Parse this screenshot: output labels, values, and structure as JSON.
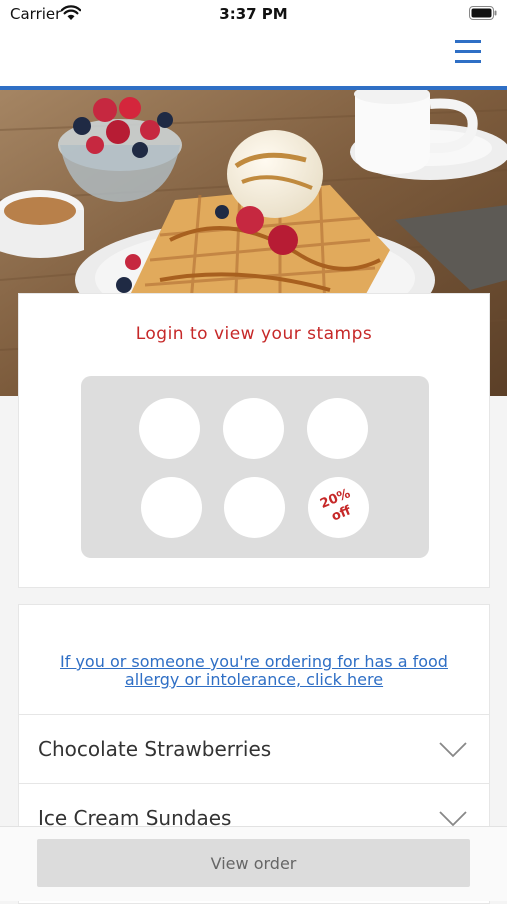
{
  "status_bar": {
    "carrier": "Carrier",
    "time": "3:37 PM",
    "icons": [
      "wifi-icon",
      "battery-icon"
    ]
  },
  "nav": {
    "menu_icon": "hamburger-menu-icon",
    "accent_color": "#2f6fc5"
  },
  "hero": {
    "image": "waffles-with-ice-cream-and-berries"
  },
  "stamp_card": {
    "title": "Login to view your stamps",
    "title_color": "#c62828",
    "stamps_total": 6,
    "stamps_collected": 0,
    "reward_lines": [
      "20%",
      "off"
    ]
  },
  "menu": {
    "allergy_link_lines": [
      "If you or someone you're ordering for has a food",
      "allergy or intolerance, click here"
    ],
    "categories": [
      {
        "label": "Chocolate Strawberries",
        "icon": "chevron-down-icon"
      },
      {
        "label": "Ice Cream Sundaes",
        "icon": "chevron-down-icon"
      }
    ]
  },
  "bottom_bar": {
    "view_order_label": "View order"
  }
}
